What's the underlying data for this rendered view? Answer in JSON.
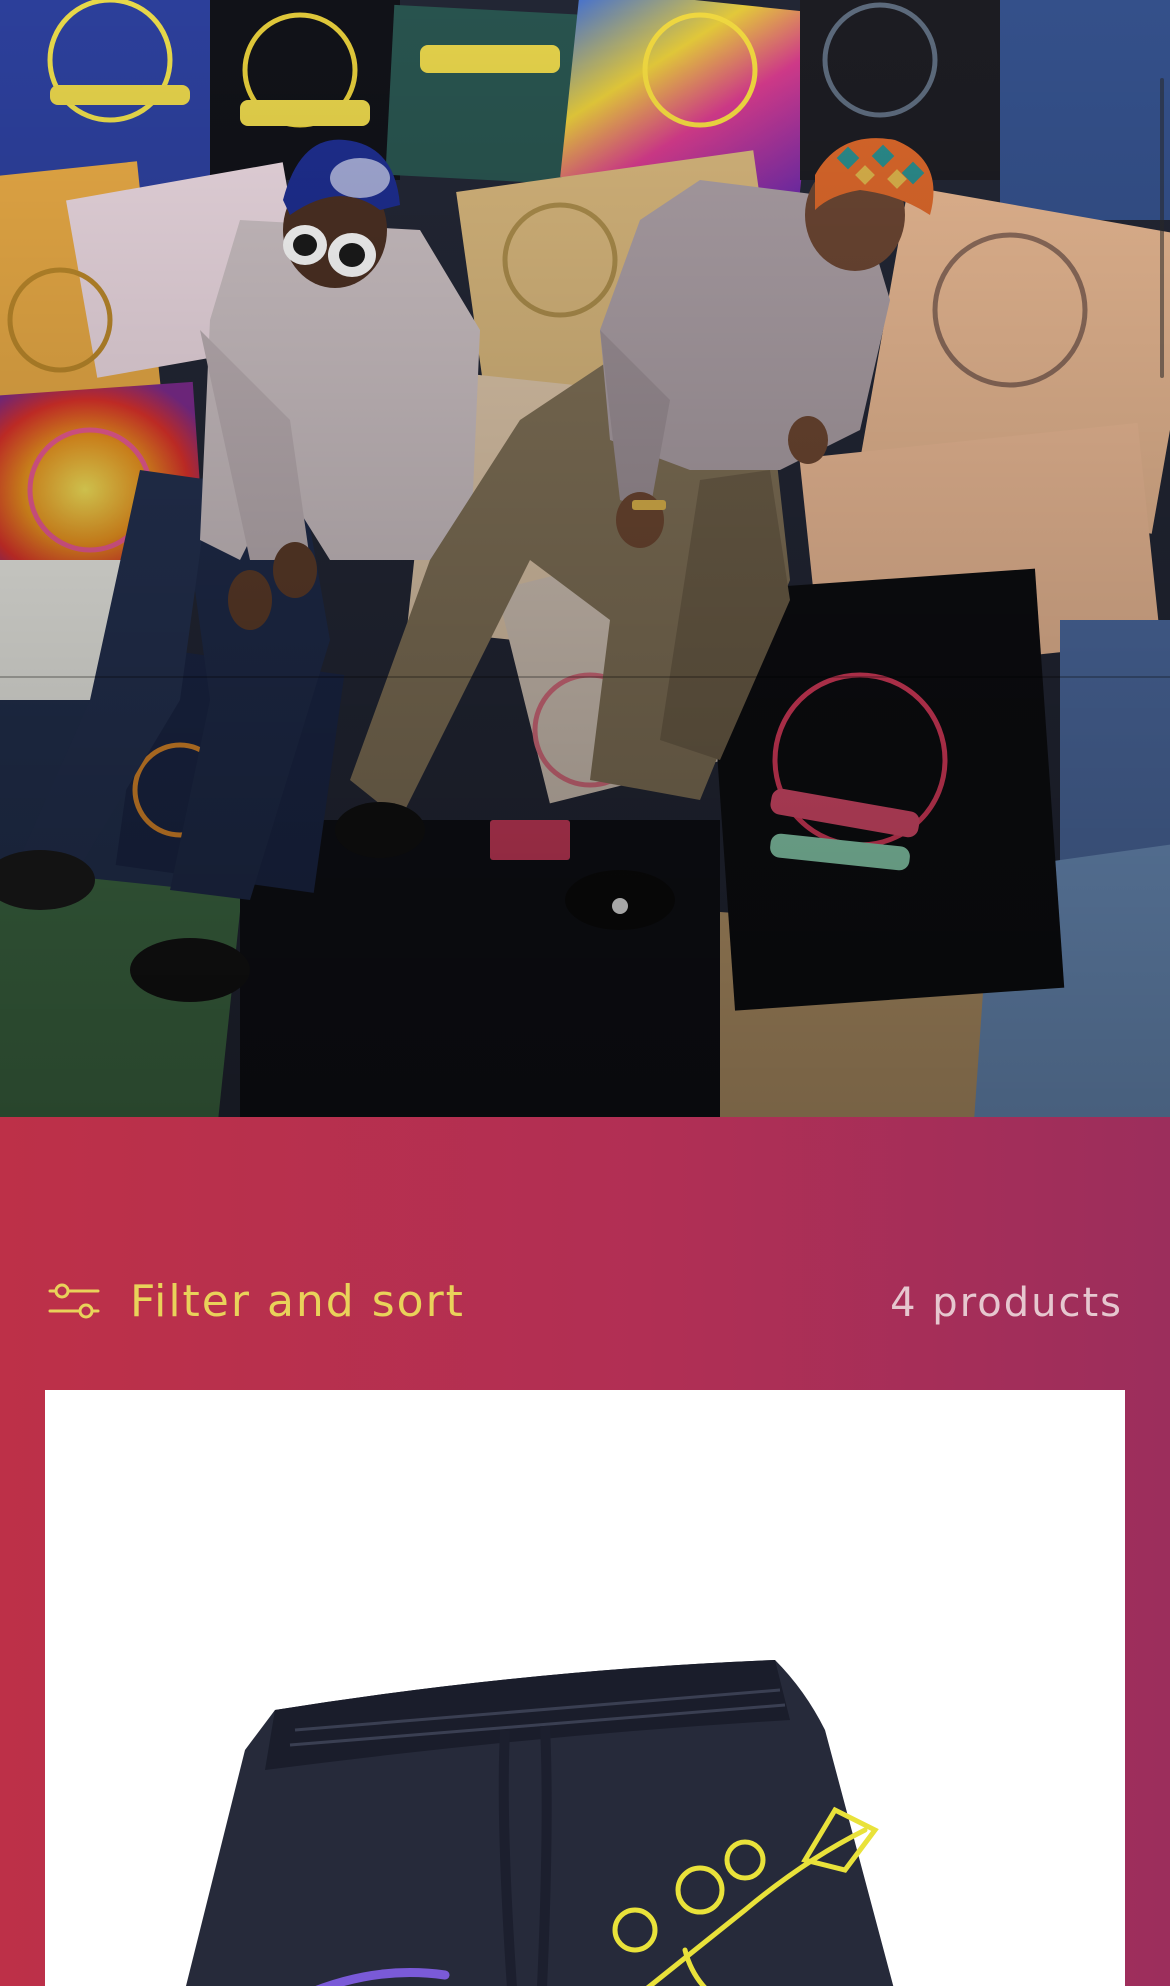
{
  "hero": {
    "image_label": "collection-hero-photo"
  },
  "toolbar": {
    "filter_label": "Filter and sort",
    "filter_icon": "sliders-icon",
    "product_count": "4 products"
  },
  "colors": {
    "panel_background": "#b83050",
    "filter_text": "#e9d25a",
    "count_text": "#e6c7cf",
    "card_background": "#ffffff"
  },
  "products": [
    {
      "name": "",
      "image": "navy-sweatshorts-with-yellow-graphic"
    }
  ]
}
